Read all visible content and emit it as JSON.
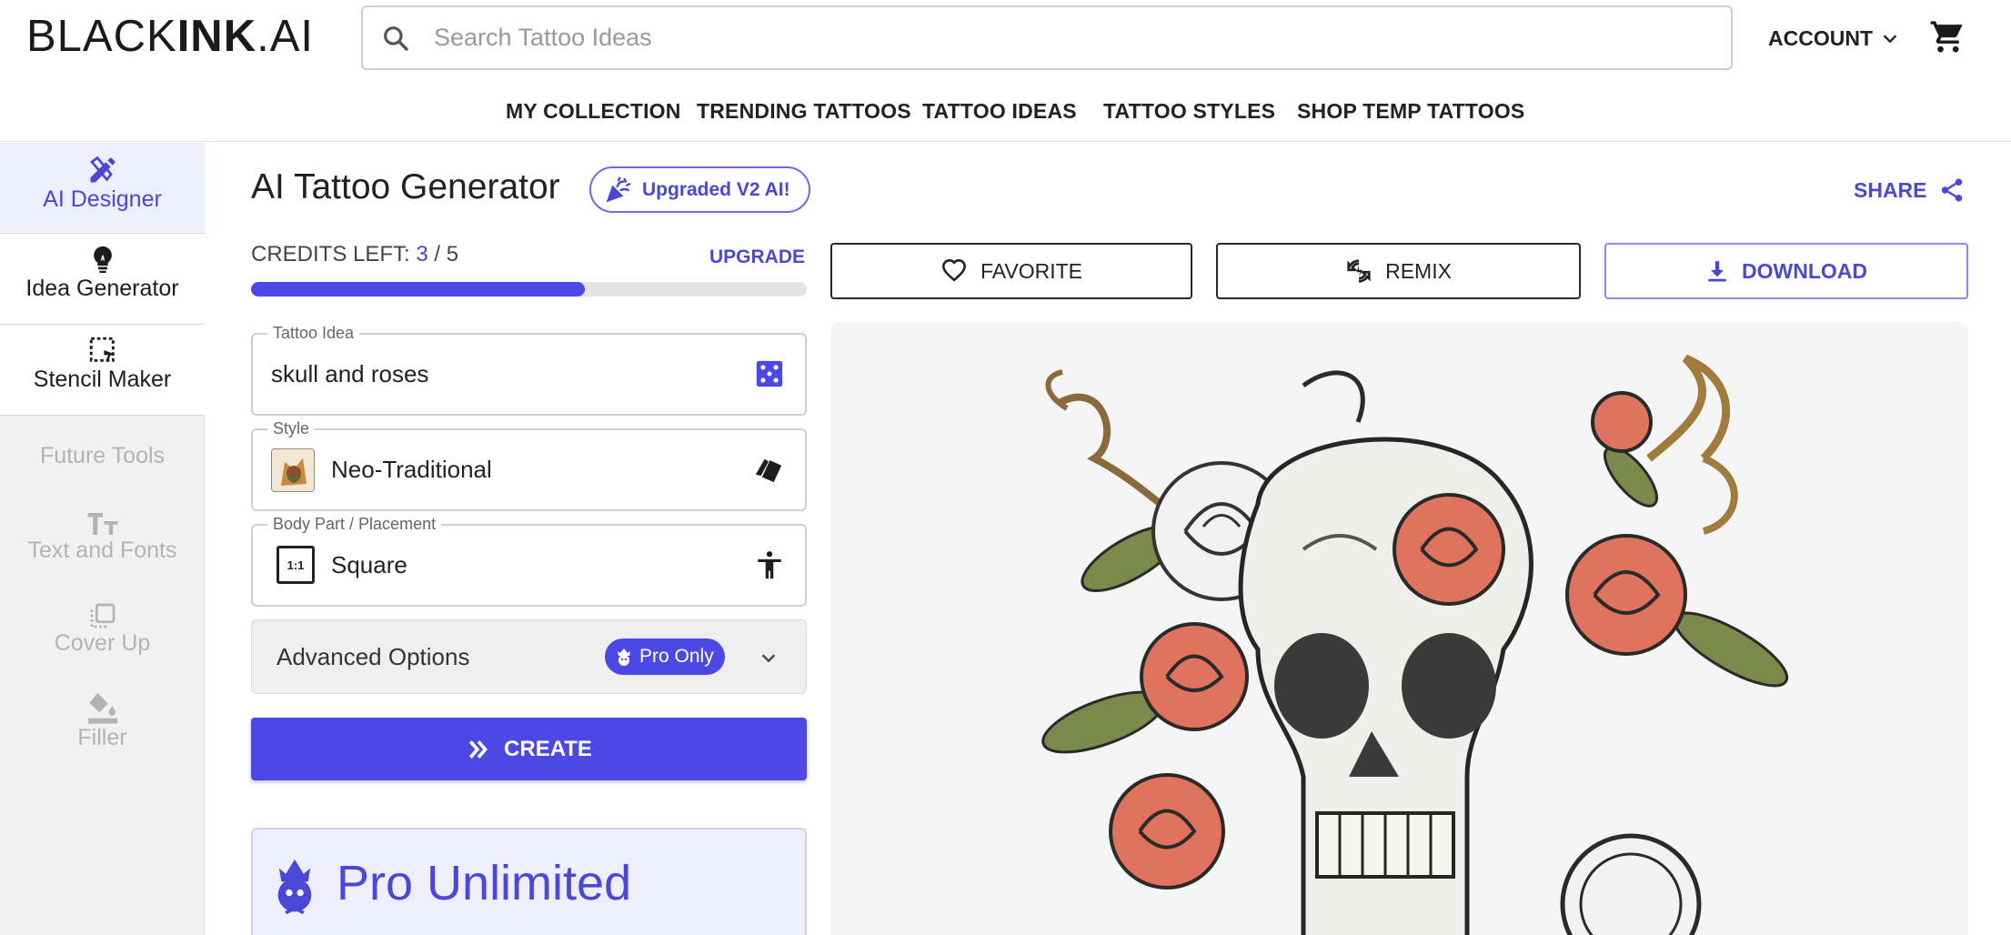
{
  "header": {
    "logo_light": "BLACK",
    "logo_bold": "INK",
    "logo_suffix": ".AI",
    "search_placeholder": "Search Tattoo Ideas",
    "account_label": "ACCOUNT",
    "cart_icon": "cart-icon"
  },
  "nav": {
    "items": [
      "MY COLLECTION",
      "TRENDING TATTOOS",
      "TATTOO IDEAS",
      "TATTOO STYLES",
      "SHOP TEMP TATTOOS"
    ]
  },
  "sidebar": {
    "items": [
      {
        "label": "AI Designer",
        "icon": "pencil-ruler-icon",
        "state": "active"
      },
      {
        "label": "Idea Generator",
        "icon": "lightbulb-icon",
        "state": "normal"
      },
      {
        "label": "Stencil Maker",
        "icon": "stencil-icon",
        "state": "normal"
      }
    ],
    "future_heading": "Future Tools",
    "future_items": [
      {
        "label": "Text and Fonts",
        "icon": "text-icon"
      },
      {
        "label": "Cover Up",
        "icon": "cover-up-icon"
      },
      {
        "label": "Filler",
        "icon": "paint-bucket-icon"
      }
    ]
  },
  "generator": {
    "title": "AI Tattoo Generator",
    "badge": "Upgraded V2 AI!",
    "credits_label": "CREDITS LEFT:",
    "credits_used": "3",
    "credits_sep": "/",
    "credits_total": "5",
    "credits_fraction": 0.6,
    "upgrade_label": "UPGRADE",
    "tattoo_idea_label": "Tattoo Idea",
    "tattoo_idea_value": "skull and roses",
    "style_label": "Style",
    "style_value": "Neo-Traditional",
    "placement_label": "Body Part / Placement",
    "placement_value": "Square",
    "placement_ratio": "1:1",
    "advanced_label": "Advanced Options",
    "pro_only_label": "Pro Only",
    "create_label": "CREATE",
    "pro_unlimited_label": "Pro Unlimited"
  },
  "result": {
    "share_label": "SHARE",
    "favorite_label": "FAVORITE",
    "remix_label": "REMIX",
    "download_label": "DOWNLOAD"
  },
  "colors": {
    "accent": "#4b48e6",
    "accent_text": "#4b48d8",
    "rose": "#e0735e",
    "leaf": "#7b8a4a"
  }
}
